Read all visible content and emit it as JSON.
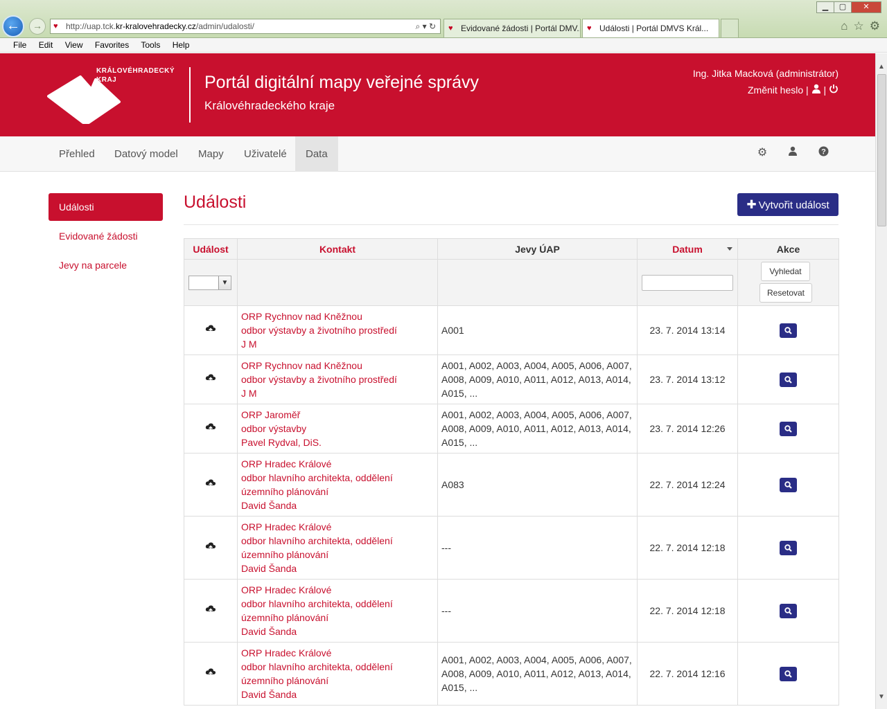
{
  "browser": {
    "address_prefix": "http://uap.tck.",
    "address_host": "kr-kralovehradecky.cz",
    "address_path": "/admin/udalosti/",
    "tabs": [
      {
        "label": "Evidované žádosti | Portál DMV..."
      },
      {
        "label": "Události | Portál DMVS Král..."
      }
    ],
    "menu": [
      "File",
      "Edit",
      "View",
      "Favorites",
      "Tools",
      "Help"
    ]
  },
  "header": {
    "logo_line1": "KRÁLOVÉHRADECKÝ",
    "logo_line2": "KRAJ",
    "title": "Portál digitální mapy veřejné správy",
    "subtitle": "Královéhradeckého kraje",
    "user": "Ing. Jitka Macková (administrátor)",
    "change_password": "Změnit heslo",
    "separator": "|"
  },
  "nav": {
    "items": [
      "Přehled",
      "Datový model",
      "Mapy",
      "Uživatelé",
      "Data"
    ],
    "active_index": 4
  },
  "sidebar": {
    "items": [
      "Události",
      "Evidované žádosti",
      "Jevy na parcele"
    ],
    "active_index": 0
  },
  "main": {
    "title": "Události",
    "create_button": "Vytvořit událost"
  },
  "table": {
    "headers": {
      "event": "Událost",
      "contact": "Kontakt",
      "phenomena": "Jevy ÚAP",
      "date": "Datum",
      "actions": "Akce"
    },
    "filter": {
      "search": "Vyhledat",
      "reset": "Resetovat"
    },
    "rows": [
      {
        "contact": [
          "ORP Rychnov nad Kněžnou",
          "odbor výstavby a životního prostředí",
          "J M"
        ],
        "phenomena": "A001",
        "date": "23. 7. 2014 13:14"
      },
      {
        "contact": [
          "ORP Rychnov nad Kněžnou",
          "odbor výstavby a životního prostředí",
          "J M"
        ],
        "phenomena": "A001, A002, A003, A004, A005, A006, A007, A008, A009, A010, A011, A012, A013, A014, A015, ...",
        "date": "23. 7. 2014 13:12"
      },
      {
        "contact": [
          "ORP Jaroměř",
          "odbor výstavby",
          "Pavel Rydval, DiS."
        ],
        "phenomena": "A001, A002, A003, A004, A005, A006, A007, A008, A009, A010, A011, A012, A013, A014, A015, ...",
        "date": "23. 7. 2014 12:26"
      },
      {
        "contact": [
          "ORP Hradec Králové",
          "odbor hlavního architekta, oddělení územního plánování",
          "David Šanda"
        ],
        "phenomena": "A083",
        "date": "22. 7. 2014 12:24"
      },
      {
        "contact": [
          "ORP Hradec Králové",
          "odbor hlavního architekta, oddělení územního plánování",
          "David Šanda"
        ],
        "phenomena": "---",
        "date": "22. 7. 2014 12:18"
      },
      {
        "contact": [
          "ORP Hradec Králové",
          "odbor hlavního architekta, oddělení územního plánování",
          "David Šanda"
        ],
        "phenomena": "---",
        "date": "22. 7. 2014 12:18"
      },
      {
        "contact": [
          "ORP Hradec Králové",
          "odbor hlavního architekta, oddělení územního plánování",
          "David Šanda"
        ],
        "phenomena": "A001, A002, A003, A004, A005, A006, A007, A008, A009, A010, A011, A012, A013, A014, A015, ...",
        "date": "22. 7. 2014 12:16"
      }
    ]
  },
  "colors": {
    "brand_red": "#c8102e",
    "button_navy": "#2a2d86"
  },
  "icons": [
    "back-arrow-icon",
    "forward-arrow-icon",
    "home-icon",
    "star-icon",
    "gear-icon",
    "user-icon",
    "power-icon",
    "help-icon",
    "plus-icon",
    "cloud-upload-icon",
    "magnifier-icon"
  ]
}
